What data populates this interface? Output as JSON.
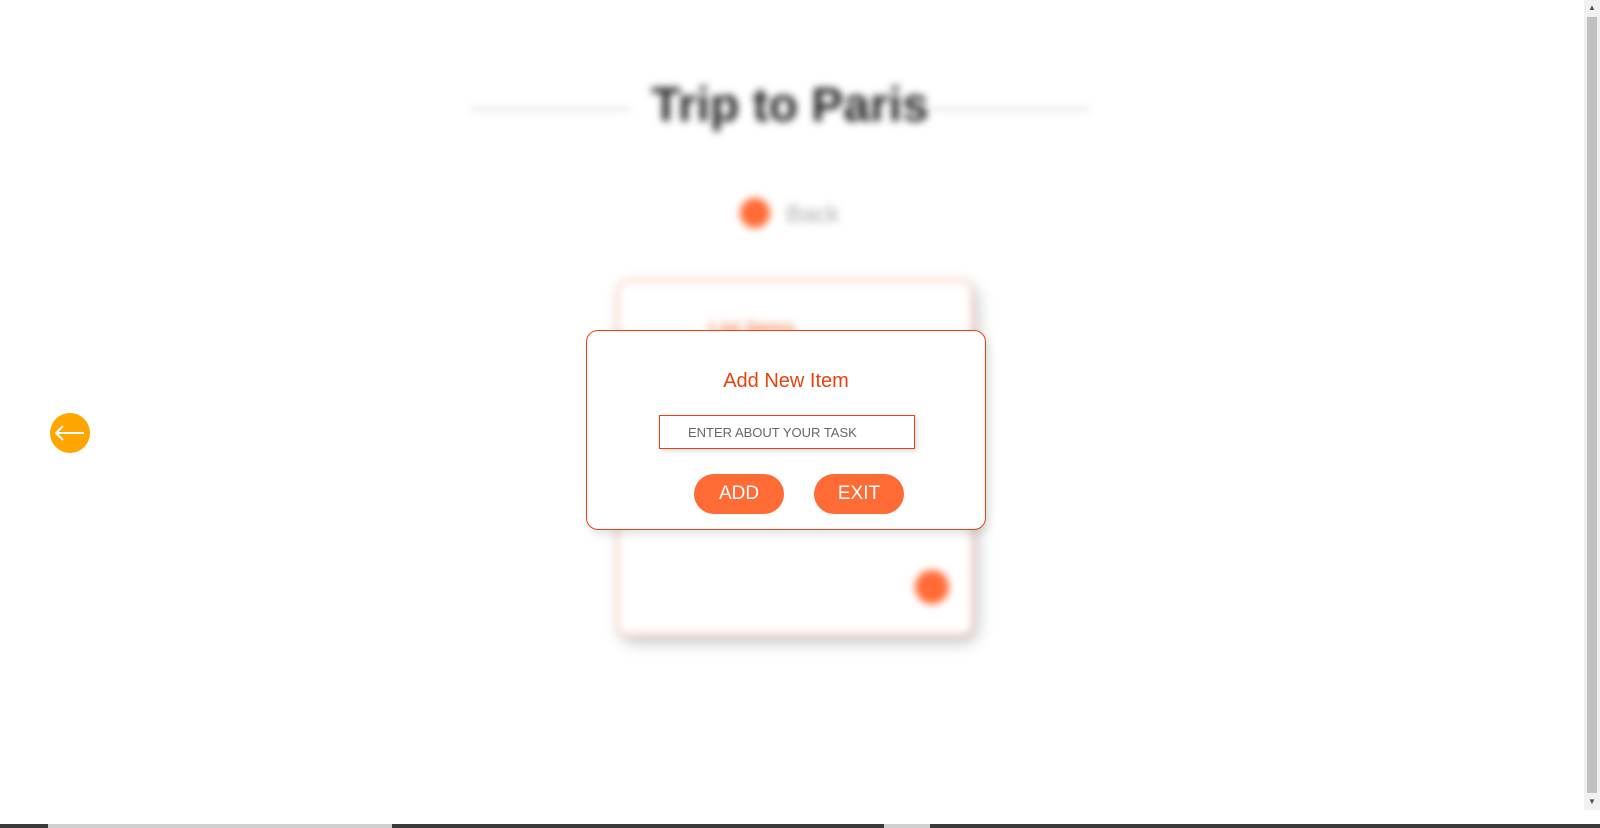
{
  "background": {
    "title": "Trip to Paris",
    "back_label": "Back",
    "card_heading": "List Items"
  },
  "fab": {
    "icon": "arrow-left-icon",
    "color": "#ffa500"
  },
  "modal": {
    "title": "Add New Item",
    "input_placeholder": "ENTER ABOUT YOUR TASK",
    "input_value": "",
    "add_label": "ADD",
    "exit_label": "EXIT"
  },
  "colors": {
    "accent": "#ff6b35",
    "modal_border": "#e8430f",
    "fab": "#ffa500"
  }
}
